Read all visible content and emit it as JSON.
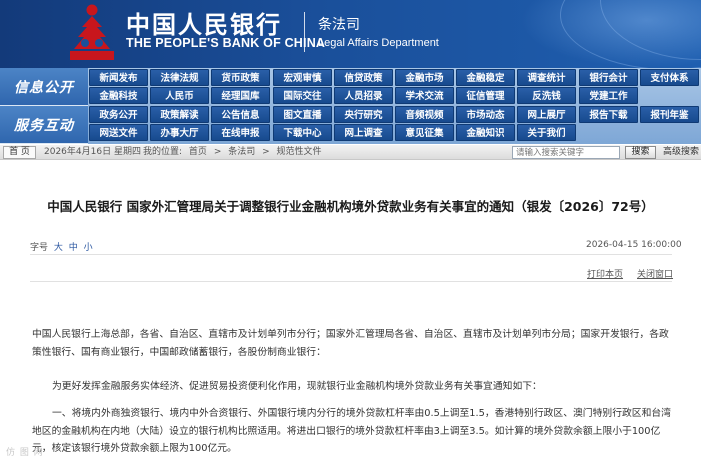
{
  "header": {
    "bank_name_cn": "中国人民银行",
    "bank_name_en": "THE PEOPLE'S BANK OF CHINA",
    "dept_cn": "条法司",
    "dept_en": "Legal Affairs Department",
    "logo_icon": "pboc-emblem-icon",
    "colors": {
      "banner": "#1a4f9a",
      "logo": "#c8161d",
      "nav_button": "#1f55a0",
      "nav_section": "#3a73b9"
    }
  },
  "nav": {
    "section_1": "信息公开",
    "section_2": "服务互动",
    "rows": [
      [
        "新闻发布",
        "法律法规",
        "货币政策",
        "宏观审慎",
        "信贷政策",
        "金融市场",
        "金融稳定",
        "调查统计",
        "银行会计",
        "支付体系"
      ],
      [
        "金融科技",
        "人民币",
        "经理国库",
        "国际交往",
        "人员招录",
        "学术交流",
        "征信管理",
        "反洗钱",
        "党建工作",
        ""
      ],
      [
        "政务公开",
        "政策解读",
        "公告信息",
        "图文直播",
        "央行研究",
        "音频视频",
        "市场动态",
        "网上展厅",
        "报告下载",
        "报刊年鉴"
      ],
      [
        "网送文件",
        "办事大厅",
        "在线申报",
        "下载中心",
        "网上调查",
        "意见征集",
        "金融知识",
        "关于我们",
        "",
        ""
      ]
    ]
  },
  "breadcrumb": {
    "home": "首 页",
    "date": "2026年4月16日 星期四",
    "location_label": "我的位置:",
    "path": [
      "首页",
      ">",
      "条法司",
      ">",
      "规范性文件"
    ],
    "search_placeholder": "请输入搜索关键字",
    "search_button": "搜索",
    "advanced_search": "高级搜索"
  },
  "article": {
    "title": "中国人民银行 国家外汇管理局关于调整银行业金融机构境外贷款业务有关事宜的通知（银发〔2026〕72号）",
    "font_size_label": "字号",
    "font_sizes": [
      "大",
      "中",
      "小"
    ],
    "publish_time": "2026-04-15 16:00:00",
    "print_link": "打印本页",
    "close_link": "关闭窗口",
    "paragraphs": [
      "中国人民银行上海总部，各省、自治区、直辖市及计划单列市分行；国家外汇管理局各省、自治区、直辖市及计划单列市分局；国家开发银行，各政策性银行、国有商业银行，中国邮政储蓄银行，各股份制商业银行：",
      "为更好发挥金融服务实体经济、促进贸易投资便利化作用，现就银行业金融机构境外贷款业务有关事宜通知如下：",
      "一、将境内外商独资银行、境内中外合资银行、外国银行境内分行的境外贷款杠杆率由0.5上调至1.5，香港特别行政区、澳门特别行政区和台湾地区的金融机构在内地（大陆）设立的银行机构比照适用。将进出口银行的境外贷款杠杆率由3上调至3.5。如计算的境外贷款余额上限小于100亿元，核定该银行境外贷款余额上限为100亿元。"
    ]
  },
  "watermark": "仿 图 网"
}
